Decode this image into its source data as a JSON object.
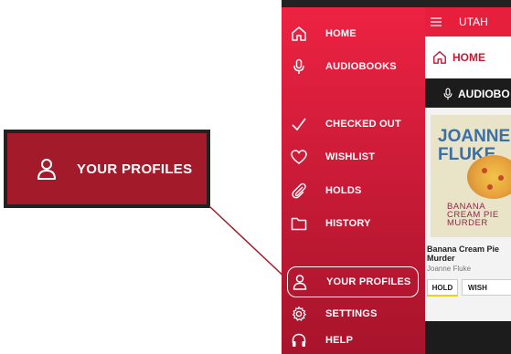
{
  "callout": {
    "label": "YOUR PROFILES",
    "icon": "user-icon"
  },
  "drawer": {
    "items": [
      {
        "label": "HOME",
        "icon": "home-icon"
      },
      {
        "label": "AUDIOBOOKS",
        "icon": "microphone-icon"
      },
      {
        "label": "CHECKED OUT",
        "icon": "checkmark-icon"
      },
      {
        "label": "WISHLIST",
        "icon": "heart-icon"
      },
      {
        "label": "HOLDS",
        "icon": "paperclip-icon"
      },
      {
        "label": "HISTORY",
        "icon": "folder-icon"
      },
      {
        "label": "YOUR PROFILES",
        "icon": "user-icon",
        "selected": true
      },
      {
        "label": "SETTINGS",
        "icon": "gear-icon"
      },
      {
        "label": "HELP",
        "icon": "headphones-icon"
      }
    ]
  },
  "content": {
    "topbar_title": "UTAH",
    "home_label": "HOME",
    "section_label": "AUDIOBO",
    "book": {
      "cover_author": "JOANNE FLUKE",
      "cover_title": "BANANA CREAM PIE MURDER",
      "title": "Banana Cream Pie Murder",
      "author": "Joanne Fluke",
      "hold_label": "HOLD",
      "wish_label": "WISH"
    }
  },
  "colors": {
    "brand_red": "#e6203c",
    "callout_bg": "#a31a2a",
    "hold_accent": "#e9cf29"
  }
}
